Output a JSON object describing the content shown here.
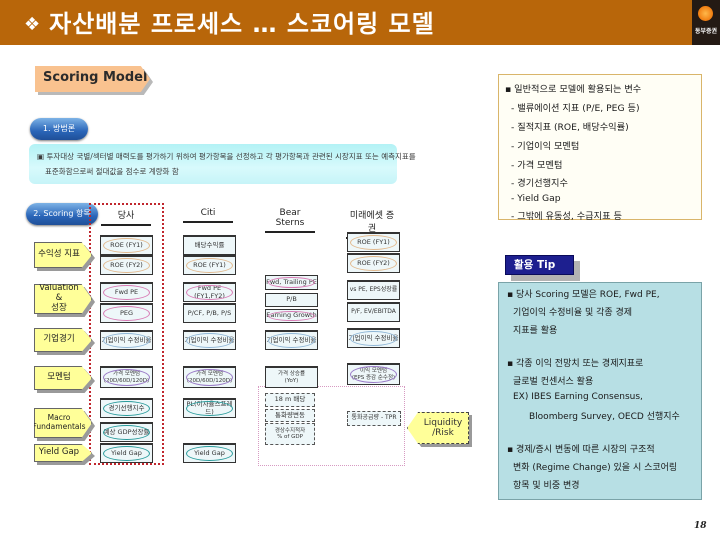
{
  "header": {
    "bullet_icon": "❖",
    "title": "자산배분 프로세스 … 스코어링 모델",
    "logo_text": "동부증권"
  },
  "tag": {
    "label": "Scoring Model"
  },
  "overview": {
    "pill": "1. 방법론",
    "line1": "▣ 투자대상 국별/섹터별 매력도를 평가하기 위하여 평가항목을 선정하고 각 평가항목과 관련된 시장지표 또는 예측지표를",
    "line2": "표준화함으로써 절대값을 점수로 계량화 함"
  },
  "diagram": {
    "pill": "2. Scoring 항목",
    "columns": [
      "당사",
      "Citi",
      "Bear Sterns",
      "미래에셋 증권"
    ],
    "rows": [
      "수익성 지표",
      "Valuation &\n성장",
      "기업경기",
      "모멘텀",
      "Macro\nFundamentals",
      "Yield Gap"
    ],
    "cells": {
      "dangsa": [
        "ROE (FY1)",
        "ROE (FY2)",
        "Fwd PE",
        "PEG",
        "기업이익 수정비율",
        "가격 모멘텀\n(20D/60D/120D)",
        "경기선행지수",
        "예상 GDP성장률",
        "Yield Gap"
      ],
      "citi": [
        "배당수익률",
        "ROE (FY1)",
        "Fwd PE (FY1,FY2)",
        "P/CF, P/B, P/S",
        "기업이익 수정비율",
        "가격 모멘텀\n(20D/60D/120D)",
        "PL(이자율스프레드)",
        "Yield Gap"
      ],
      "bear": [
        "Fwd, Trailing PE",
        "P/B",
        "Earning Growth",
        "기업이익 수정비율",
        "가격 상승률\n(YoY)",
        "18 m 배당",
        "통화량변동",
        "경상수지적자\n% of GDP",
        "통화공급량 - TPR"
      ],
      "mirae": [
        "ROE (FY1)",
        "ROE (FY2)",
        "vs PE, EPS성장률",
        "P/F, EV/EBITDA",
        "기업이익 수정비율",
        "이익 모멘텀\n(EPS 증감 순수정)"
      ]
    },
    "liquidity": "Liquidity\n/Risk"
  },
  "variables": {
    "heading": "▪ 일반적으로 모델에 활용되는 변수",
    "items": [
      "- 밸류에이션 지표 (P/E, PEG 등)",
      "- 질적지표 (ROE, 배당수익률)",
      "- 기업이익 모멘텀",
      "- 가격 모멘텀",
      "- 경기선행지수",
      "- Yield Gap",
      "- 그밖에 유동성, 수급지표 등"
    ]
  },
  "tip": {
    "label": "활용 Tip",
    "b1": [
      "▪ 당사 Scoring 모델은 ROE, Fwd PE,",
      "기업이익 수정비율 및 각종 경제",
      "지표를 활용"
    ],
    "b2": [
      "▪ 각종 이익 전망치 또는 경제지표로",
      "글로벌 컨센서스 활용",
      "EX) IBES Earning Consensus,",
      "Bloomberg Survey, OECD 선행지수"
    ],
    "b3": [
      "▪ 경제/증시 변동에 따른 시장의 구조적",
      "변화 (Regime Change) 있을 시 스코어링",
      "항목 및 비중 변경"
    ]
  },
  "page_number": "18"
}
